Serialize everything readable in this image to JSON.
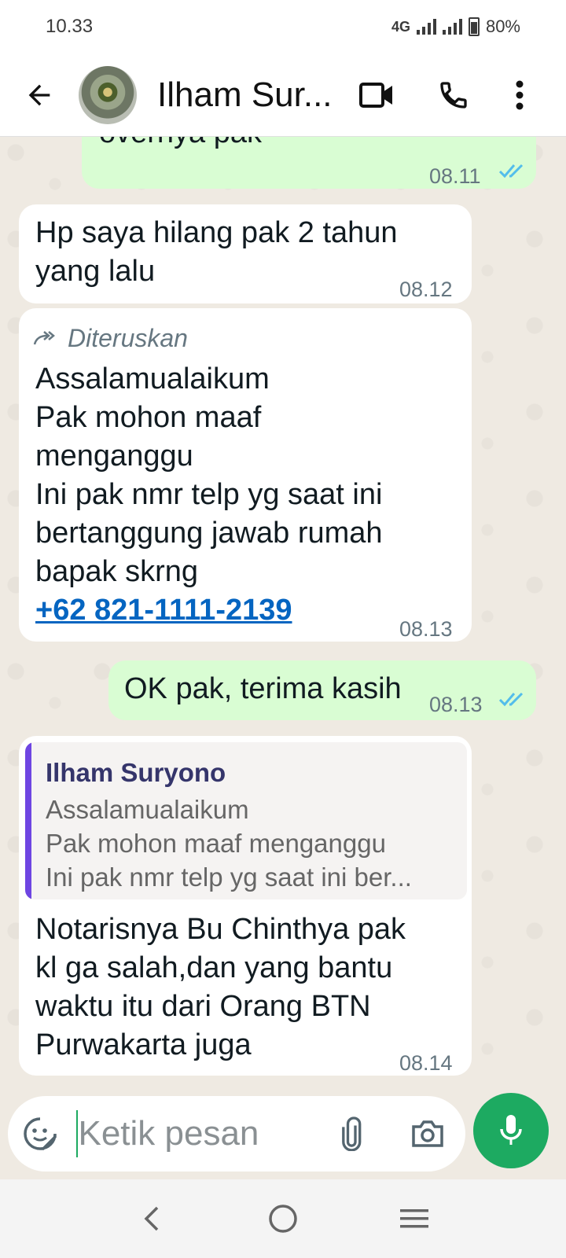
{
  "status_bar": {
    "time": "10.33",
    "network": "4G",
    "battery": "80%"
  },
  "header": {
    "contact_name": "Ilham Sur..."
  },
  "messages": [
    {
      "direction": "outgoing",
      "text": "overnya pak",
      "time": "08.11",
      "status": "read"
    },
    {
      "direction": "incoming",
      "lines": [
        "Hp saya hilang pak 2 tahun",
        "yang lalu"
      ],
      "time": "08.12"
    },
    {
      "direction": "incoming",
      "forwarded_label": "Diteruskan",
      "lines": [
        "Assalamualaikum",
        "Pak mohon maaf",
        "menganggu",
        "Ini pak nmr telp yg saat ini",
        "bertanggung jawab rumah",
        "bapak skrng"
      ],
      "link": "+62 821-1111-2139",
      "time": "08.13"
    },
    {
      "direction": "outgoing",
      "text": "OK pak, terima kasih",
      "time": "08.13",
      "status": "read"
    },
    {
      "direction": "incoming",
      "quote": {
        "author": "Ilham Suryono",
        "lines": [
          "Assalamualaikum",
          "Pak mohon maaf menganggu",
          "Ini pak nmr telp yg saat ini ber..."
        ]
      },
      "lines": [
        "Notarisnya Bu Chinthya pak",
        "kl ga salah,dan yang bantu",
        "waktu itu dari Orang BTN",
        "Purwakarta juga"
      ],
      "time": "08.14"
    }
  ],
  "composer": {
    "placeholder": "Ketik pesan"
  },
  "colors": {
    "incoming_bubble": "#ffffff",
    "outgoing_bubble": "#d9fdd3",
    "accent_green": "#1daa61",
    "read_ticks": "#53bdeb",
    "link": "#0565c1"
  }
}
